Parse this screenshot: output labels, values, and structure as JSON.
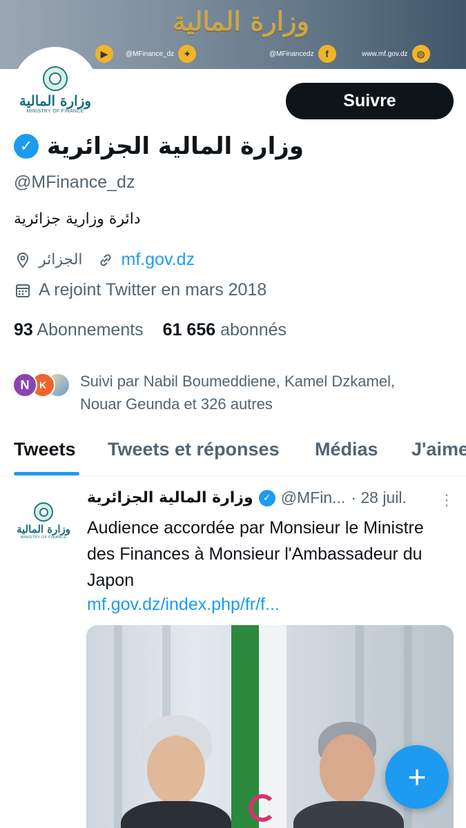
{
  "banner": {
    "title": "وزارة المالية",
    "items": [
      {
        "icon": "youtube-icon",
        "glyph": "▶",
        "text": ""
      },
      {
        "icon": "twitter-icon",
        "glyph": "✦",
        "text": "@MFinance_dz"
      },
      {
        "icon": "facebook-icon",
        "glyph": "f",
        "text": "@MFinancedz"
      },
      {
        "icon": "globe-icon",
        "glyph": "◍",
        "text": "www.mf.gov.dz"
      }
    ]
  },
  "profile": {
    "logo_ar": "وزارة المالية",
    "logo_en": "MINISTRY OF FINANCE",
    "follow_label": "Suivre",
    "display_name": "وزارة المالية الجزائرية",
    "handle": "@MFinance_dz",
    "bio": "دائرة وزارية جزائرية",
    "location": "الجزائر",
    "website": "mf.gov.dz",
    "joined": "A rejoint Twitter en mars 2018",
    "following_count": "93",
    "following_label": "Abonnements",
    "followers_count": "61 656",
    "followers_label": "abonnés",
    "followed_by_avatar_letter": "N",
    "followed_by_avatar_letter_2": "K",
    "followed_by_line1": "Suivi par Nabil Boumeddiene, Kamel Dzkamel,",
    "followed_by_line2": "Nouar Geunda et 326 autres"
  },
  "tabs": [
    {
      "label": "Tweets",
      "active": true
    },
    {
      "label": "Tweets et réponses",
      "active": false
    },
    {
      "label": "Médias",
      "active": false
    },
    {
      "label": "J'aime",
      "active": false
    }
  ],
  "tweet": {
    "name": "وزارة المالية الجزائرية",
    "handle": "@MFin...",
    "date": "· 28 juil.",
    "more": "⋮",
    "text": "Audience accordée par Monsieur le Ministre des Finances à Monsieur l'Ambassadeur du Japon",
    "link": "mf.gov.dz/index.php/fr/f..."
  },
  "fab": {
    "glyph": "+"
  },
  "colors": {
    "accent": "#1d9bf0",
    "text": "#0f1419",
    "muted": "#536471"
  }
}
